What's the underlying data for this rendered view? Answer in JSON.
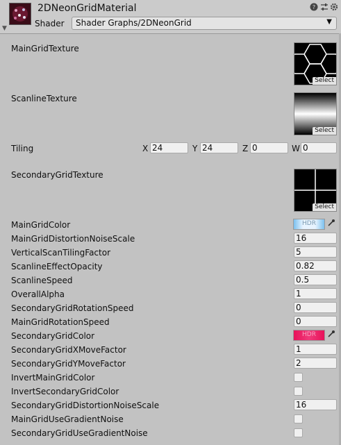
{
  "header": {
    "material_name": "2DNeonGridMaterial",
    "shader_label": "Shader",
    "shader_value": "Shader Graphs/2DNeonGrid",
    "icons": [
      "help-icon",
      "preset-icon",
      "settings-icon"
    ]
  },
  "properties": {
    "main_grid_texture": {
      "label": "MainGridTexture",
      "select": "Select"
    },
    "scanline_texture": {
      "label": "ScanlineTexture",
      "select": "Select"
    },
    "tiling": {
      "label": "Tiling",
      "x_label": "X",
      "x": "24",
      "y_label": "Y",
      "y": "24",
      "z_label": "Z",
      "z": "0",
      "w_label": "W",
      "w": "0"
    },
    "secondary_grid_texture": {
      "label": "SecondaryGridTexture",
      "select": "Select"
    },
    "main_grid_color": {
      "label": "MainGridColor",
      "badge": "HDR",
      "color": "#8cc8f0"
    },
    "rows": [
      {
        "label": "MainGridDistortionNoiseScale",
        "value": "16"
      },
      {
        "label": "VerticalScanTilingFactor",
        "value": "5"
      },
      {
        "label": "ScanlineEffectOpacity",
        "value": "0.82"
      },
      {
        "label": "ScanlineSpeed",
        "value": "0.5"
      },
      {
        "label": "OverallAlpha",
        "value": "1"
      },
      {
        "label": "SecondaryGridRotationSpeed",
        "value": "0"
      },
      {
        "label": "MainGridRotationSpeed",
        "value": "0"
      }
    ],
    "secondary_grid_color": {
      "label": "SecondaryGridColor",
      "badge": "HDR",
      "color": "#e8125a"
    },
    "rows2": [
      {
        "label": "SecondaryGridXMoveFactor",
        "value": "1"
      },
      {
        "label": "SecondaryGridYMoveFactor",
        "value": "2"
      }
    ],
    "checks": [
      {
        "label": "InvertMainGridColor",
        "checked": false
      },
      {
        "label": "InvertSecondaryGridColor",
        "checked": false
      }
    ],
    "secondary_noise": {
      "label": "SecondaryGridDistortionNoiseScale",
      "value": "16"
    },
    "checks2": [
      {
        "label": "MainGridUseGradientNoise",
        "checked": false
      },
      {
        "label": "SecondaryGridUseGradientNoise",
        "checked": false
      }
    ]
  }
}
